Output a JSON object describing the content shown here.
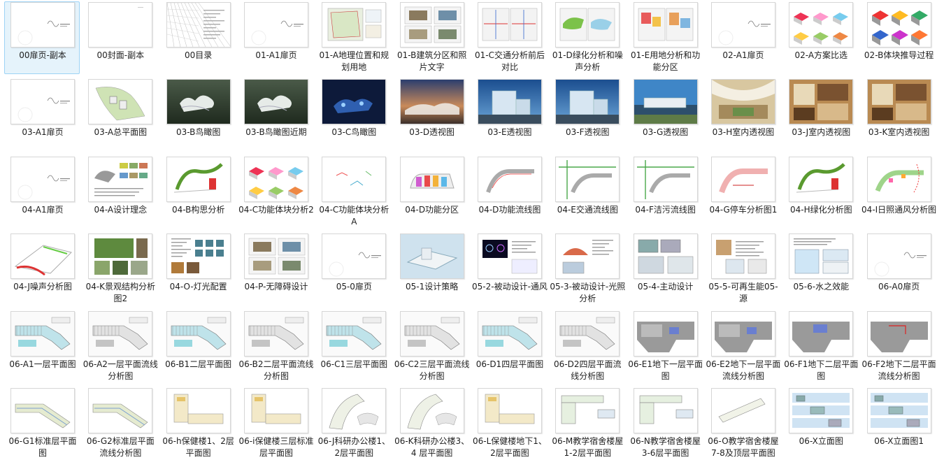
{
  "window": {
    "title": "",
    "view": "large-icons"
  },
  "colors": {
    "selection_bg": "#e5f3fb",
    "selection_border": "#9dd3f5",
    "text": "#1e1e1e"
  },
  "files": [
    {
      "name": "00扉页-副本",
      "thumb": "title-page",
      "selected": true
    },
    {
      "name": "00封面-副本",
      "thumb": "blank-page"
    },
    {
      "name": "00目录",
      "thumb": "toc-sketch"
    },
    {
      "name": "01-A1扉页",
      "thumb": "title-page"
    },
    {
      "name": "01-A地理位置和规划用地",
      "thumb": "site-map"
    },
    {
      "name": "01-B建筑分区和照片文字",
      "thumb": "photo-grid"
    },
    {
      "name": "01-C交通分析前后对比",
      "thumb": "traffic-map"
    },
    {
      "name": "01-D绿化分析和噪声分析",
      "thumb": "green-map"
    },
    {
      "name": "01-E用地分析和功能分区",
      "thumb": "zone-map"
    },
    {
      "name": "02-A1扉页",
      "thumb": "title-page"
    },
    {
      "name": "02-A方案比选",
      "thumb": "massing-study"
    },
    {
      "name": "02-B体块推导过程",
      "thumb": "massing-color"
    },
    {
      "name": "03-A1扉页",
      "thumb": "title-page"
    },
    {
      "name": "03-A总平面图",
      "thumb": "master-plan"
    },
    {
      "name": "03-B鸟瞰图",
      "thumb": "aerial-green"
    },
    {
      "name": "03-B鸟瞰图近期",
      "thumb": "aerial-green"
    },
    {
      "name": "03-C鸟瞰图",
      "thumb": "aerial-night"
    },
    {
      "name": "03-D透视图",
      "thumb": "perspective-dusk"
    },
    {
      "name": "03-E透视图",
      "thumb": "perspective-blue"
    },
    {
      "name": "03-F透视图",
      "thumb": "perspective-blue"
    },
    {
      "name": "03-G透视图",
      "thumb": "perspective-day"
    },
    {
      "name": "03-H室内透视图",
      "thumb": "interior-warm"
    },
    {
      "name": "03-J室内透视图",
      "thumb": "interior-wood"
    },
    {
      "name": "03-K室内透视图",
      "thumb": "interior-wood"
    },
    {
      "name": "04-A1扉页",
      "thumb": "title-page"
    },
    {
      "name": "04-A设计理念",
      "thumb": "concept-board"
    },
    {
      "name": "04-B构思分析",
      "thumb": "green-ribbon"
    },
    {
      "name": "04-C功能体块分析2",
      "thumb": "massing-study"
    },
    {
      "name": "04-C功能体块分析A",
      "thumb": "diagram-sparse"
    },
    {
      "name": "04-D功能分区",
      "thumb": "function-zones"
    },
    {
      "name": "04-D功能流线图",
      "thumb": "plan-lines"
    },
    {
      "name": "04-E交通流线图",
      "thumb": "plan-green-lines"
    },
    {
      "name": "04-F洁污流线图",
      "thumb": "plan-green-lines"
    },
    {
      "name": "04-G停车分析图1",
      "thumb": "plan-red"
    },
    {
      "name": "04-H绿化分析图",
      "thumb": "green-ribbon"
    },
    {
      "name": "04-I日照通风分析图",
      "thumb": "plan-colored"
    },
    {
      "name": "04-J噪声分析图",
      "thumb": "noise-plan"
    },
    {
      "name": "04-K景观结构分析图2",
      "thumb": "landscape-photos"
    },
    {
      "name": "04-O-灯光配置",
      "thumb": "lighting-board"
    },
    {
      "name": "04-P-无障碍设计",
      "thumb": "photo-grid"
    },
    {
      "name": "05-0扉页",
      "thumb": "title-page"
    },
    {
      "name": "05-1设计策略",
      "thumb": "strategy-3d"
    },
    {
      "name": "05-2-被动设计-通风",
      "thumb": "ventilation-board"
    },
    {
      "name": "05-3-被动设计-光照分析",
      "thumb": "sun-board"
    },
    {
      "name": "05-4-主动设计",
      "thumb": "active-board"
    },
    {
      "name": "05-5-可再生能05-源",
      "thumb": "energy-board"
    },
    {
      "name": "05-6-水之效能",
      "thumb": "water-board"
    },
    {
      "name": "06-A0扉页",
      "thumb": "title-page"
    },
    {
      "name": "06-A1一层平面图",
      "thumb": "floor-plan-teal"
    },
    {
      "name": "06-A2一层平面流线分析图",
      "thumb": "floor-plan-gray"
    },
    {
      "name": "06-B1二层平面图",
      "thumb": "floor-plan-teal"
    },
    {
      "name": "06-B2二层平面流线分析图",
      "thumb": "floor-plan-gray"
    },
    {
      "name": "06-C1三层平面图",
      "thumb": "floor-plan-teal"
    },
    {
      "name": "06-C2三层平面流线分析图",
      "thumb": "floor-plan-gray"
    },
    {
      "name": "06-D1四层平面图",
      "thumb": "floor-plan-teal"
    },
    {
      "name": "06-D2四层平面流线分析图",
      "thumb": "floor-plan-gray"
    },
    {
      "name": "06-E1地下一层平面图",
      "thumb": "basement-plan"
    },
    {
      "name": "06-E2地下一层平面流线分析图",
      "thumb": "basement-plan"
    },
    {
      "name": "06-F1地下二层平面图",
      "thumb": "basement-blue"
    },
    {
      "name": "06-F2地下二层平面流线分析图",
      "thumb": "basement-red"
    },
    {
      "name": "06-G1标准层平面图",
      "thumb": "standard-plan"
    },
    {
      "name": "06-G2标准层平面流线分析图",
      "thumb": "standard-plan"
    },
    {
      "name": "06-h保健楼1、2层平面图",
      "thumb": "clinic-plan"
    },
    {
      "name": "06-i保健楼三层标准层平面图",
      "thumb": "clinic-plan"
    },
    {
      "name": "06-J科研办公楼1、2层平面图",
      "thumb": "curve-plan"
    },
    {
      "name": "06-K科研办公楼3、4 层平面图",
      "thumb": "curve-plan"
    },
    {
      "name": "06-L保健楼地下1、2层平面图",
      "thumb": "clinic-plan"
    },
    {
      "name": "06-M教学宿舍楼屋1-2层平面图",
      "thumb": "dorm-plan"
    },
    {
      "name": "06-N教学宿舍楼屋3-6层平面图",
      "thumb": "dorm-plan"
    },
    {
      "name": "06-O教学宿舍楼屋7-8及顶层平面图",
      "thumb": "dorm-line"
    },
    {
      "name": "06-X立面图",
      "thumb": "elevation"
    },
    {
      "name": "06-X立面图1",
      "thumb": "elevation"
    }
  ]
}
